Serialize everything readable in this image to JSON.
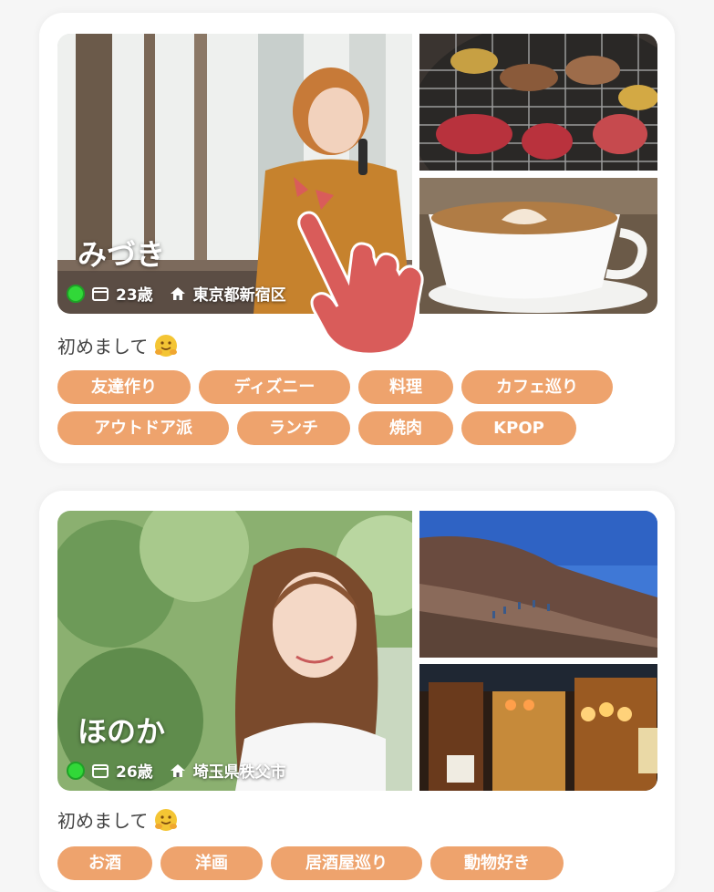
{
  "profiles": [
    {
      "name": "みづき",
      "age": "23歳",
      "location": "東京都新宿区",
      "greeting": "初めまして",
      "online": true,
      "tags_row1": [
        "友達作り",
        "ディズニー",
        "料理",
        "カフェ巡り"
      ],
      "tags_row2": [
        "アウトドア派",
        "ランチ",
        "焼肉",
        "KPOP"
      ],
      "photos": [
        "woman-on-phone-photo",
        "yakiniku-grill-photo",
        "latte-art-photo"
      ]
    },
    {
      "name": "ほのか",
      "age": "26歳",
      "location": "埼玉県秩父市",
      "greeting": "初めまして",
      "online": true,
      "tags_row1": [
        "お酒",
        "洋画",
        "居酒屋巡り",
        "動物好き"
      ],
      "photos": [
        "smiling-woman-photo",
        "mountain-hiking-photo",
        "izakaya-alley-photo"
      ]
    }
  ],
  "colors": {
    "tag": "#eea36d",
    "online": "#31d838",
    "hand": "#d95c5a"
  },
  "icons": [
    "calendar-icon",
    "home-icon",
    "hugging-face-emoji",
    "tap-hand-icon"
  ]
}
